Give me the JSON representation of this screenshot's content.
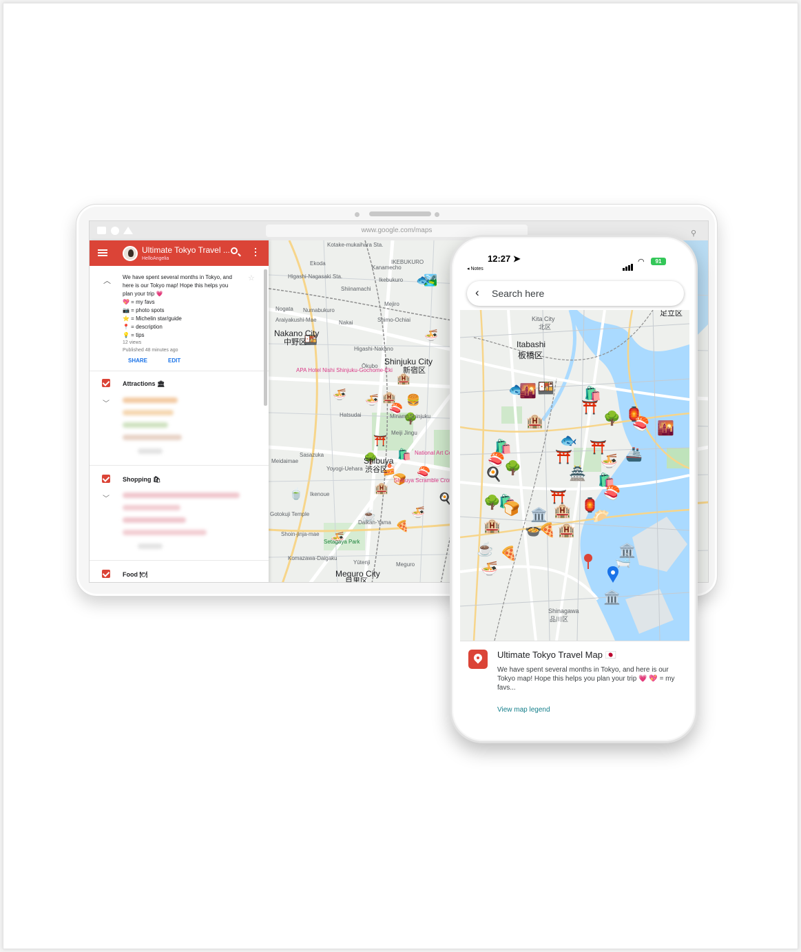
{
  "browser": {
    "url": "www.google.com/maps"
  },
  "panel": {
    "map_title": "Ultimate Tokyo Travel ...",
    "author": "HelloAngelia",
    "description_lines": [
      "We have spent several months in Tokyo, and",
      "here is our Tokyo map! Hope this helps you",
      "plan your trip 💗",
      "💖 = my favs",
      "📷 = photo spots",
      "⭐ = Michelin star/guide",
      "📍 = description",
      "💡 = tips"
    ],
    "views": "12 views",
    "published": "Published 48 minutes ago",
    "share_label": "SHARE",
    "edit_label": "EDIT",
    "layers": [
      {
        "name": "Attractions 🏛"
      },
      {
        "name": "Shopping 🛍"
      },
      {
        "name": "Food 🍽"
      }
    ]
  },
  "map_labels": {
    "tablet": [
      "Kotake-mukaihara Sta.",
      "Ekoda",
      "Kanamecho",
      "IKEBUKURO",
      "Higashi-Nagasaki Sta.",
      "Ikebukuro",
      "Shiinamachi",
      "Nogata",
      "Numabukuro",
      "Mejiro",
      "Araiyakushi-Mae",
      "Nakai",
      "Shimo-Ochiai",
      "Nakano City",
      "中野区",
      "Higashi-Nakano",
      "Shinjuku City",
      "新宿区",
      "Ōkubo",
      "APA Hotel Nishi Shinjuku-Gochome-Eki",
      "Meiji Jingu",
      "Hatsudai",
      "Minami-Shinjuku",
      "Meidaimae",
      "Sasazuka",
      "Shibuya",
      "渋谷区",
      "Yoyogi-Uehara",
      "Shibuya Scramble Crossing",
      "National Art Center",
      "Ikenoue",
      "Daikan-Yama",
      "Gotokuji Temple",
      "Shoin-jinja-mae",
      "Setagaya Park",
      "Komazawa-Daigaku",
      "Yūtenji",
      "Meguro",
      "Meguro City",
      "目黒区"
    ],
    "phone": [
      "Kita City",
      "北区",
      "Itabashi",
      "板橋区",
      "Shinagawa",
      "品川区",
      "足立区"
    ]
  },
  "phone": {
    "status_time": "12:27",
    "back_label": "◂ Notes",
    "battery": "91",
    "search_placeholder": "Search here",
    "sheet_title": "Ultimate Tokyo Travel Map 🇯🇵",
    "sheet_description": "We have spent several months in Tokyo, and here is our Tokyo map! Hope this helps you plan your trip 💗 💖 = my favs...",
    "legend_link": "View map legend"
  },
  "colors": {
    "accent_red": "#db4437",
    "link_blue": "#1a73e8",
    "link_teal": "#137e8a",
    "water": "#aadaff",
    "park": "#c8e6c9",
    "battery_green": "#34c759"
  }
}
